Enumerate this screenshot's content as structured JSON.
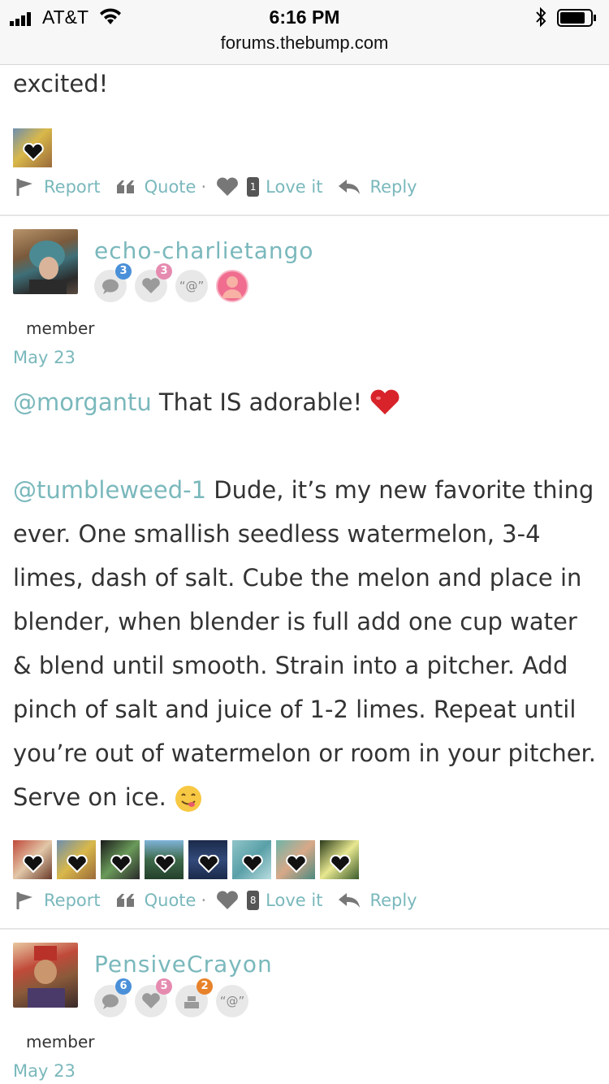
{
  "status_bar": {
    "carrier": "AT&T",
    "time": "6:16 PM",
    "url": "forums.thebump.com"
  },
  "post_prev": {
    "text_tail": "excited!",
    "actions": {
      "report": "Report",
      "quote": "Quote",
      "dot": "·",
      "love_count": "1",
      "love": "Love it",
      "reply": "Reply"
    }
  },
  "post1": {
    "username": "echo-charlietango",
    "badges": {
      "comments": "3",
      "likes": "3",
      "mention": "“@”"
    },
    "role": "member",
    "date": "May 23",
    "mention1": "@morgantu",
    "line1": " That IS adorable! ",
    "mention2": "@tumbleweed-1",
    "body_l1": " Dude, it’s my new favorite thing",
    "body_l2": "ever. One smallish seedless watermelon, 3-4",
    "body_l3": "limes, dash of salt. Cube the melon and place in",
    "body_l4": "blender, when blender is full add one cup water",
    "body_l5": "& blend until smooth. Strain into a pitcher. Add",
    "body_l6": "pinch of salt and juice of 1-2 limes. Repeat until",
    "body_l7": "you’re out of watermelon or room in your pitcher.",
    "body_l8": "Serve on ice. ",
    "actions": {
      "report": "Report",
      "quote": "Quote",
      "dot": "·",
      "love_count": "8",
      "love": "Love it",
      "reply": "Reply"
    }
  },
  "post2": {
    "username": "PensiveCrayon",
    "badges": {
      "comments": "6",
      "likes": "5",
      "posts": "2",
      "mention": "“@”"
    },
    "role": "member",
    "date": "May 23"
  },
  "colors": {
    "accent": "#7ab8bc",
    "badge_blue": "#4a90d9",
    "badge_pink": "#e68bb0",
    "badge_orange": "#e8822a"
  }
}
